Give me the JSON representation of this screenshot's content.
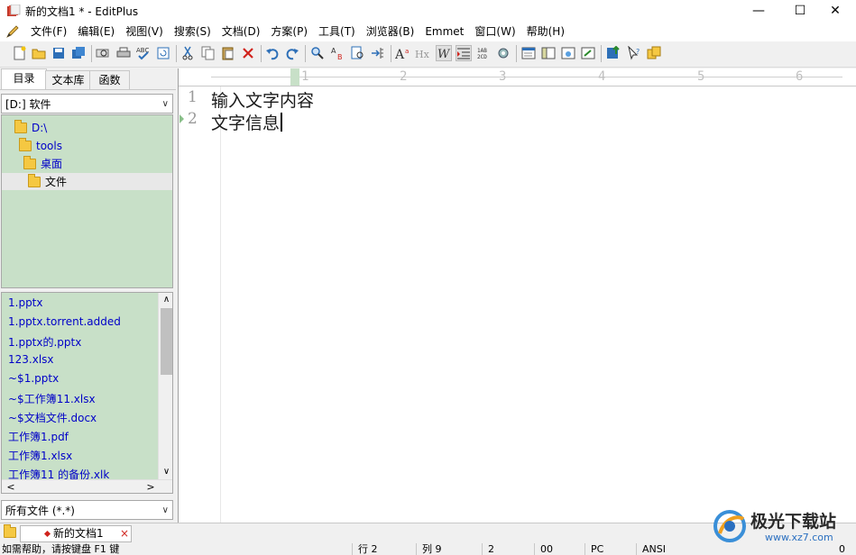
{
  "window": {
    "title": "新的文档1 * - EditPlus",
    "minimize_glyph": "—",
    "maximize_glyph": "☐",
    "close_glyph": "✕"
  },
  "menu": {
    "items": [
      "文件(F)",
      "编辑(E)",
      "视图(V)",
      "搜索(S)",
      "文档(D)",
      "方案(P)",
      "工具(T)",
      "浏览器(B)",
      "Emmet",
      "窗口(W)",
      "帮助(H)"
    ],
    "mdi_min": "_",
    "mdi_restore": "▫",
    "mdi_close": "×"
  },
  "toolbar": {
    "icons": [
      "new-file-icon",
      "open-file-icon",
      "save-icon",
      "save-all-icon",
      "print-preview-icon",
      "print-icon",
      "spell-check-icon",
      "refresh-icon",
      "cut-icon",
      "copy-icon",
      "paste-icon",
      "delete-icon",
      "undo-icon",
      "redo-icon",
      "find-icon",
      "replace-icon",
      "find-in-files-icon",
      "goto-line-icon",
      "font-size-icon",
      "html-icon",
      "word-wrap-icon",
      "indent-icon",
      "column-select-icon",
      "settings-icon",
      "output-window-icon",
      "cliptext-icon",
      "browser-icon",
      "user-tool-icon",
      "ftp-upload-icon",
      "help-icon",
      "cliptext-library-icon"
    ]
  },
  "sidebar": {
    "tabs": [
      "目录",
      "文本库",
      "函数"
    ],
    "active_tab": "目录",
    "drive_select": "[D:] 软件",
    "tree": [
      {
        "label": "D:\\",
        "indent": 0,
        "selected": false
      },
      {
        "label": "tools",
        "indent": 1,
        "selected": false
      },
      {
        "label": "桌面",
        "indent": 2,
        "selected": false
      },
      {
        "label": "文件",
        "indent": 3,
        "selected": true
      }
    ],
    "files": [
      "1.pptx",
      "1.pptx.torrent.added",
      "1.pptx的.pptx",
      "123.xlsx",
      "~$1.pptx",
      "~$工作簿11.xlsx",
      "~$文档文件.docx",
      "工作簿1.pdf",
      "工作簿1.xlsx",
      "工作簿11 的备份.xlk"
    ],
    "filter_select": "所有文件 (*.*)",
    "scroll_up": "∧",
    "scroll_down": "∨",
    "scroll_left": "<",
    "scroll_right": ">",
    "dropdown_arrow": "∨"
  },
  "editor": {
    "ruler_numbers": [
      "1",
      "2",
      "3",
      "4",
      "5",
      "6"
    ],
    "lines": [
      {
        "number": "1",
        "text": "输入文字内容"
      },
      {
        "number": "2",
        "text": "文字信息"
      }
    ]
  },
  "doc_tabs": {
    "items": [
      {
        "label": "新的文档1",
        "close": "×"
      }
    ]
  },
  "status": {
    "help": "如需帮助，请按键盘 F1 键",
    "row": "行 2",
    "col": "列 9",
    "num": "2",
    "hex": "00",
    "eol": "PC",
    "encoding": "ANSI",
    "extra": "0"
  },
  "watermark": {
    "name": "极光下载站",
    "url": "www.xz7.com"
  },
  "colors": {
    "panel_green": "#c8e0c8",
    "link_blue": "#0000c8",
    "ruler_gray": "#bfbfbf"
  }
}
